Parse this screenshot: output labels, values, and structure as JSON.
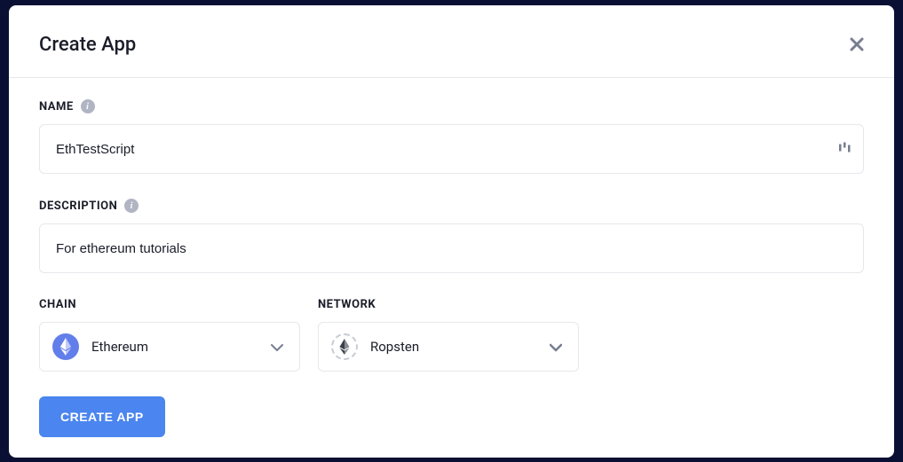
{
  "modal": {
    "title": "Create App"
  },
  "fields": {
    "name": {
      "label": "NAME",
      "value": "EthTestScript"
    },
    "description": {
      "label": "DESCRIPTION",
      "value": "For ethereum tutorials"
    },
    "chain": {
      "label": "CHAIN",
      "selected": "Ethereum"
    },
    "network": {
      "label": "NETWORK",
      "selected": "Ropsten"
    }
  },
  "actions": {
    "submit": "CREATE APP"
  }
}
